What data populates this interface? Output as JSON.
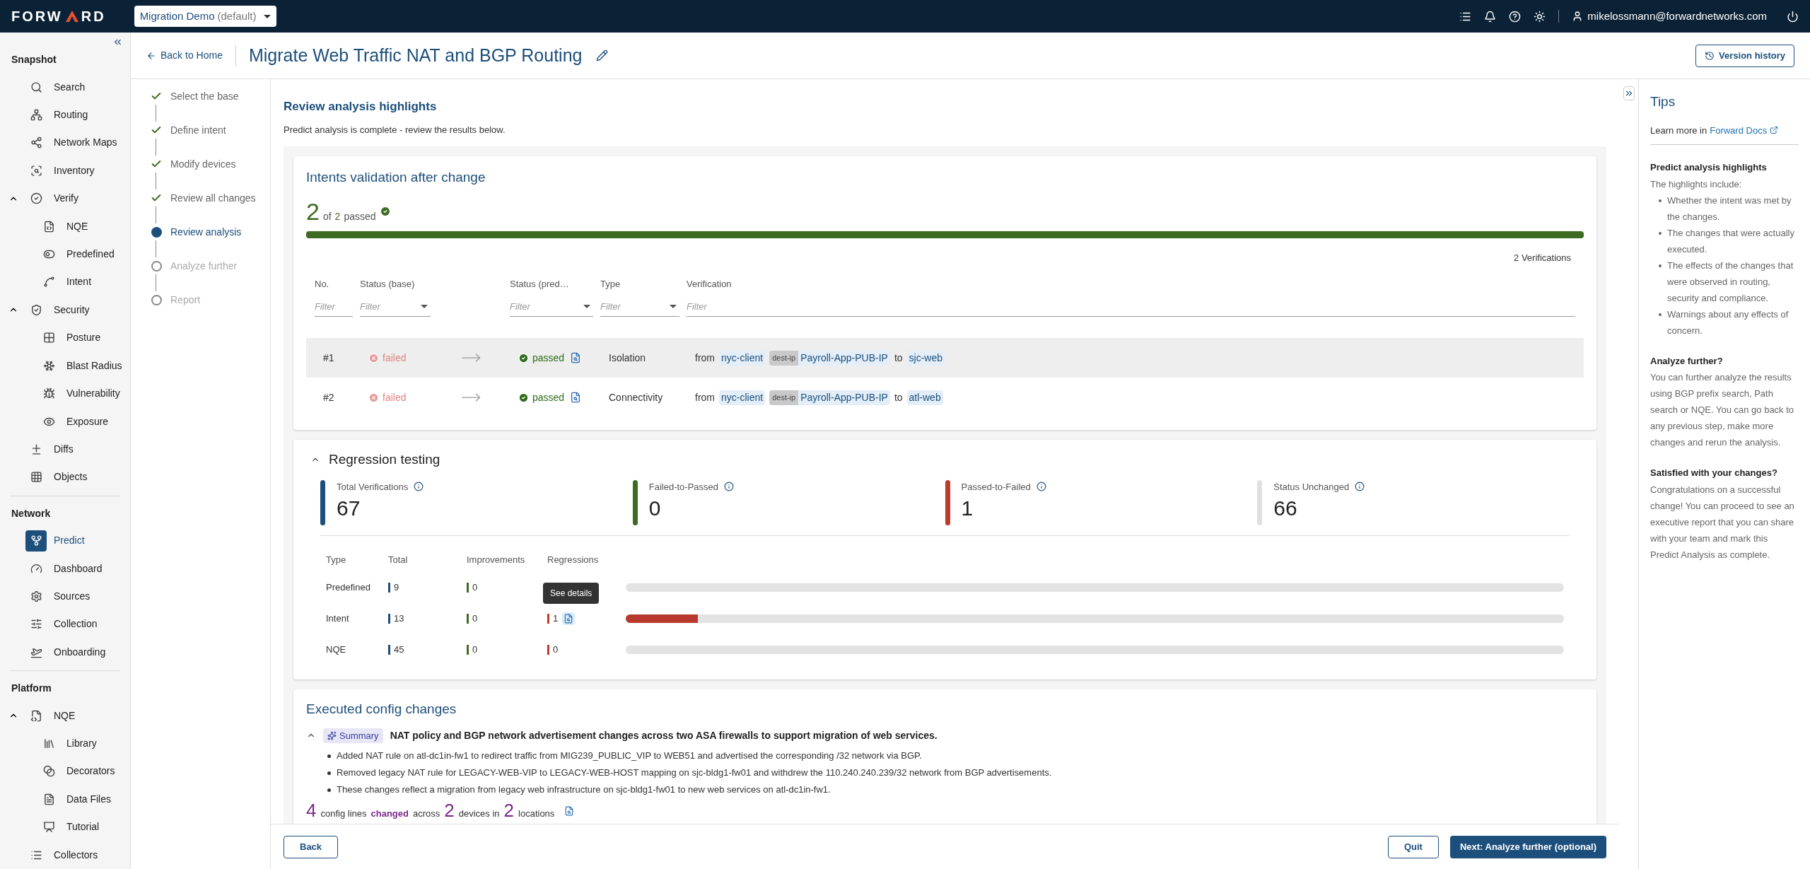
{
  "header": {
    "logo_left": "FORW",
    "logo_right": "RD",
    "workspace": "Migration Demo",
    "workspace_note": "(default)",
    "user": "mikelossmann@forwardnetworks.com"
  },
  "sidebar": {
    "sections": [
      {
        "title": "Snapshot",
        "items": [
          {
            "label": "Search",
            "selected": false
          },
          {
            "label": "Routing",
            "selected": false
          },
          {
            "label": "Network Maps",
            "selected": false
          },
          {
            "label": "Inventory",
            "selected": false
          },
          {
            "label": "Verify",
            "selected": false,
            "expanded": true,
            "children": [
              {
                "label": "NQE",
                "selected": false
              },
              {
                "label": "Predefined",
                "selected": false
              },
              {
                "label": "Intent",
                "selected": false
              }
            ]
          },
          {
            "label": "Security",
            "selected": false,
            "expanded": true,
            "children": [
              {
                "label": "Posture",
                "selected": false
              },
              {
                "label": "Blast Radius",
                "selected": false
              },
              {
                "label": "Vulnerability",
                "selected": false
              },
              {
                "label": "Exposure",
                "selected": false
              }
            ]
          },
          {
            "label": "Diffs",
            "selected": false
          },
          {
            "label": "Objects",
            "selected": false
          }
        ]
      },
      {
        "title": "Network",
        "items": [
          {
            "label": "Predict",
            "selected": true
          },
          {
            "label": "Dashboard",
            "selected": false
          },
          {
            "label": "Sources",
            "selected": false
          },
          {
            "label": "Collection",
            "selected": false
          },
          {
            "label": "Onboarding",
            "selected": false
          }
        ]
      },
      {
        "title": "Platform",
        "items": [
          {
            "label": "NQE",
            "selected": false,
            "expanded": true,
            "children": [
              {
                "label": "Library",
                "selected": false
              },
              {
                "label": "Decorators",
                "selected": false
              },
              {
                "label": "Data Files",
                "selected": false
              },
              {
                "label": "Tutorial",
                "selected": false
              }
            ]
          },
          {
            "label": "Collectors",
            "selected": false
          }
        ]
      }
    ]
  },
  "page": {
    "back": "Back to Home",
    "title": "Migrate Web Traffic NAT and BGP Routing",
    "version_history": "Version history"
  },
  "steps": [
    {
      "label": "Select the base",
      "kind": "done"
    },
    {
      "label": "Define intent",
      "kind": "done"
    },
    {
      "label": "Modify devices",
      "kind": "done"
    },
    {
      "label": "Review all changes",
      "kind": "done"
    },
    {
      "label": "Review analysis",
      "kind": "current"
    },
    {
      "label": "Analyze further",
      "kind": "todo"
    },
    {
      "label": "Report",
      "kind": "todo"
    }
  ],
  "review": {
    "title": "Review analysis highlights",
    "subtitle": "Predict analysis is complete - review the results below."
  },
  "intents": {
    "title": "Intents validation after change",
    "passed_count": "2",
    "of": "of",
    "total": "2",
    "passed_label": "passed",
    "level": 1.0,
    "verifications": "2 Verifications",
    "columns": [
      {
        "label": "No.",
        "filter": "Filter",
        "dropdown": false
      },
      {
        "label": "Status (base)",
        "filter": "Filter",
        "dropdown": true
      },
      {
        "label": "Status (pred…",
        "filter": "Filter",
        "dropdown": true
      },
      {
        "label": "Type",
        "filter": "Filter",
        "dropdown": true
      },
      {
        "label": "Verification",
        "filter": "Filter",
        "dropdown": false
      }
    ],
    "rows": [
      {
        "no": "#1",
        "base": {
          "kind": "failed",
          "label": "failed"
        },
        "pred": {
          "kind": "passed",
          "label": "passed"
        },
        "type": "Isolation",
        "from": "from",
        "source": "nyc-client",
        "qualifier": "dest-ip",
        "dest": "Payroll-App-PUB-IP",
        "to": "to",
        "target": "sjc-web",
        "selected": true
      },
      {
        "no": "#2",
        "base": {
          "kind": "failed",
          "label": "failed"
        },
        "pred": {
          "kind": "passed",
          "label": "passed"
        },
        "type": "Connectivity",
        "from": "from",
        "source": "nyc-client",
        "qualifier": "dest-ip",
        "dest": "Payroll-App-PUB-IP",
        "to": "to",
        "target": "atl-web",
        "selected": false
      }
    ]
  },
  "regression": {
    "title": "Regression testing",
    "expanded": true,
    "stats": [
      {
        "label": "Total Verifications",
        "value": "67",
        "color": "#1d4f7c"
      },
      {
        "label": "Failed-to-Passed",
        "value": "0",
        "color": "#3d6b21"
      },
      {
        "label": "Passed-to-Failed",
        "value": "1",
        "color": "#c0392b"
      },
      {
        "label": "Status Unchanged",
        "value": "66",
        "color": "#e0e0e0"
      }
    ],
    "columns": [
      "Type",
      "Total",
      "Improvements",
      "Regressions"
    ],
    "tooltip": "See details",
    "rows": [
      {
        "type": "Predefined",
        "total": "9",
        "improvements": "0",
        "regressions": null,
        "details": false,
        "level": 0
      },
      {
        "type": "Intent",
        "total": "13",
        "improvements": "0",
        "regressions": "1",
        "details": true,
        "level": 0.077
      },
      {
        "type": "NQE",
        "total": "45",
        "improvements": "0",
        "regressions": "0",
        "details": false,
        "level": 0
      }
    ]
  },
  "config_changes": {
    "title": "Executed config changes",
    "badge": "Summary",
    "summary": "NAT policy and BGP network advertisement changes across two ASA firewalls to support migration of web services.",
    "bullets": [
      "Added NAT rule on atl-dc1in-fw1 to redirect traffic from MIG239_PUBLIC_VIP to WEB51 and advertised the corresponding /32 network via BGP.",
      "Removed legacy NAT rule for LEGACY-WEB-VIP to LEGACY-WEB-HOST mapping on sjc-bldg1-fw01 and withdrew the 110.240.240.239/32 network from BGP advertisements.",
      "These changes reflect a migration from legacy web infrastructure on sjc-bldg1-fw01 to new web services on atl-dc1in-fw1."
    ],
    "footer": [
      {
        "text": "4",
        "kind": "number"
      },
      {
        "text": "config lines",
        "kind": "plain"
      },
      {
        "text": "changed",
        "kind": "emphasis"
      },
      {
        "text": "across",
        "kind": "plain"
      },
      {
        "text": "2",
        "kind": "number"
      },
      {
        "text": "devices in",
        "kind": "plain"
      },
      {
        "text": "2",
        "kind": "number"
      },
      {
        "text": "locations",
        "kind": "plain"
      }
    ]
  },
  "buttons": {
    "back": "Back",
    "quit": "Quit",
    "next": "Next: Analyze further (optional)"
  },
  "tips": {
    "title": "Tips",
    "learn": "Learn more in",
    "link": "Forward Docs",
    "sections": [
      {
        "heading": "Predict analysis highlights",
        "text": "The highlights include:",
        "bullets": [
          "Whether the intent was met by the changes.",
          "The changes that were actually executed.",
          "The effects of the changes that were observed in routing, security and compliance.",
          "Warnings about any effects of concern."
        ]
      },
      {
        "heading": "Analyze further?",
        "text": "You can further analyze the results using BGP prefix search, Path search or NQE. You can go back to any previous step, make more changes and rerun the analysis."
      },
      {
        "heading": "Satisfied with your changes?",
        "text": "Congratulations on a successful change! You can proceed to see an executive report that you can share with your team and mark this Predict Analysis as complete."
      }
    ]
  }
}
